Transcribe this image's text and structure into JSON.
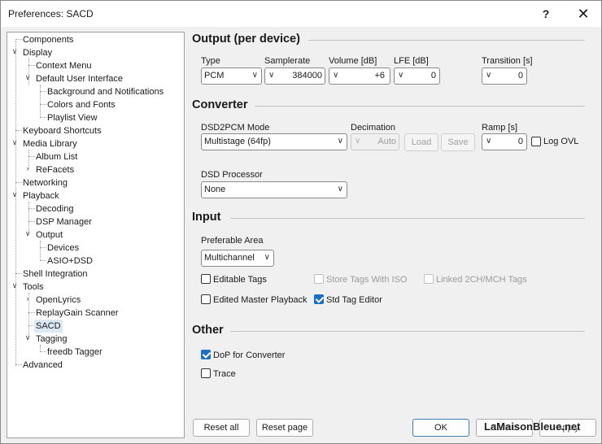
{
  "window": {
    "title": "Preferences: SACD",
    "help_glyph": "?",
    "close_glyph": "✕"
  },
  "tree": {
    "items": [
      "Components",
      "Display",
      "Context Menu",
      "Default User Interface",
      "Background and Notifications",
      "Colors and Fonts",
      "Playlist View",
      "Keyboard Shortcuts",
      "Media Library",
      "Album List",
      "ReFacets",
      "Networking",
      "Playback",
      "Decoding",
      "DSP Manager",
      "Output",
      "Devices",
      "ASIO+DSD",
      "Shell Integration",
      "Tools",
      "OpenLyrics",
      "ReplayGain Scanner",
      "SACD",
      "Tagging",
      "freedb Tagger",
      "Advanced"
    ],
    "selected": "SACD"
  },
  "output": {
    "heading": "Output (per device)",
    "type_label": "Type",
    "type_value": "PCM",
    "samplerate_label": "Samplerate",
    "samplerate_value": "384000",
    "volume_label": "Volume [dB]",
    "volume_value": "+6",
    "lfe_label": "LFE [dB]",
    "lfe_value": "0",
    "transition_label": "Transition [s]",
    "transition_value": "0"
  },
  "converter": {
    "heading": "Converter",
    "mode_label": "DSD2PCM Mode",
    "mode_value": "Multistage (64fp)",
    "decimation_label": "Decimation",
    "decimation_value": "Auto",
    "load_label": "Load",
    "save_label": "Save",
    "ramp_label": "Ramp [s]",
    "ramp_value": "0",
    "logovl_label": "Log OVL",
    "logovl_checked": false,
    "processor_label": "DSD Processor",
    "processor_value": "None"
  },
  "input": {
    "heading": "Input",
    "area_label": "Preferable Area",
    "area_value": "Multichannel",
    "editable_tags": "Editable Tags",
    "editable_tags_checked": false,
    "store_tags": "Store Tags With ISO",
    "store_tags_checked": false,
    "linked": "Linked 2CH/MCH Tags",
    "linked_checked": false,
    "edited_master": "Edited Master Playback",
    "edited_master_checked": false,
    "std_tag": "Std Tag Editor",
    "std_tag_checked": true
  },
  "other": {
    "heading": "Other",
    "dop": "DoP for Converter",
    "dop_checked": true,
    "trace": "Trace",
    "trace_checked": false
  },
  "footer": {
    "reset_all": "Reset all",
    "reset_page": "Reset page",
    "ok": "OK",
    "cancel": "Cancel",
    "apply": "Apply"
  },
  "watermark": "LaMaisonBleue.net"
}
